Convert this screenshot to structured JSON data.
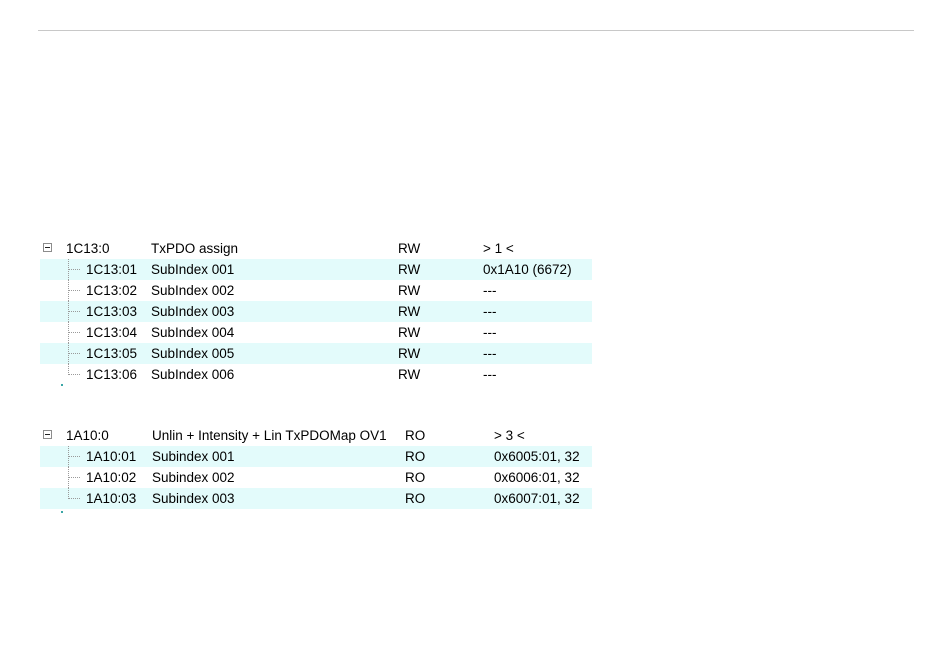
{
  "object_1": {
    "header": {
      "index": "1C13:0",
      "name": "TxPDO assign",
      "flags": "RW",
      "value": "> 1 <"
    },
    "rows": [
      {
        "index": "1C13:01",
        "name": "SubIndex 001",
        "flags": "RW",
        "value": "0x1A10 (6672)"
      },
      {
        "index": "1C13:02",
        "name": "SubIndex 002",
        "flags": "RW",
        "value": "---"
      },
      {
        "index": "1C13:03",
        "name": "SubIndex 003",
        "flags": "RW",
        "value": "---"
      },
      {
        "index": "1C13:04",
        "name": "SubIndex 004",
        "flags": "RW",
        "value": "---"
      },
      {
        "index": "1C13:05",
        "name": "SubIndex 005",
        "flags": "RW",
        "value": "---"
      },
      {
        "index": "1C13:06",
        "name": "SubIndex 006",
        "flags": "RW",
        "value": "---"
      }
    ]
  },
  "object_2": {
    "header": {
      "index": "1A10:0",
      "name": "Unlin + Intensity + Lin TxPDOMap OV1",
      "flags": "RO",
      "value": "> 3 <"
    },
    "rows": [
      {
        "index": "1A10:01",
        "name": "Subindex 001",
        "flags": "RO",
        "value": "0x6005:01, 32"
      },
      {
        "index": "1A10:02",
        "name": "Subindex 002",
        "flags": "RO",
        "value": "0x6006:01, 32"
      },
      {
        "index": "1A10:03",
        "name": "Subindex 003",
        "flags": "RO",
        "value": "0x6007:01, 32"
      }
    ]
  },
  "colors": {
    "alt_row": "#e3fbfb",
    "tree_line": "#9a9a9a"
  },
  "icons": {
    "expander": "collapse-minus-icon"
  }
}
